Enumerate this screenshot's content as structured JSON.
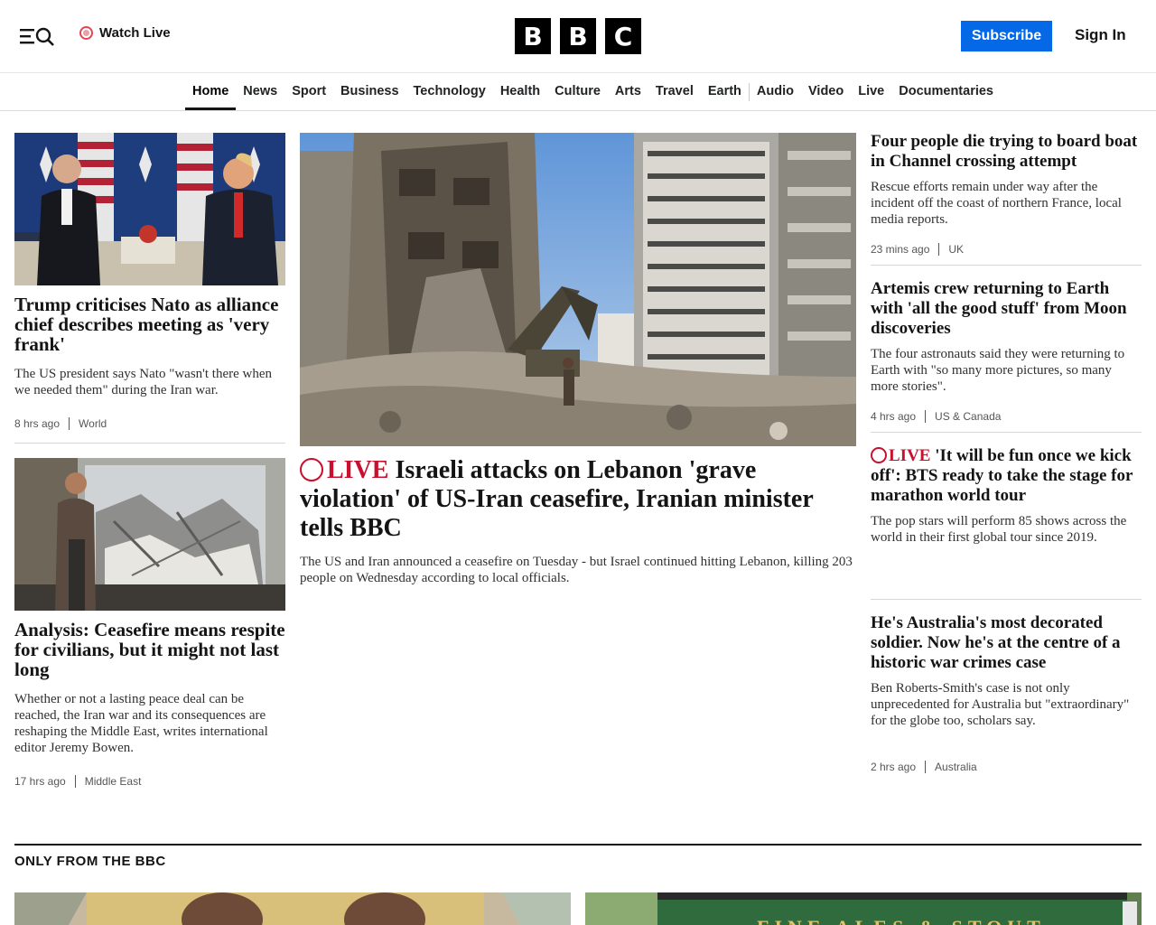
{
  "header": {
    "watch_live": "Watch Live",
    "logo_letters": [
      "B",
      "B",
      "C"
    ],
    "subscribe": "Subscribe",
    "sign_in": "Sign In"
  },
  "nav": {
    "items": [
      "Home",
      "News",
      "Sport",
      "Business",
      "Technology",
      "Health",
      "Culture",
      "Arts",
      "Travel",
      "Earth",
      "Audio",
      "Video",
      "Live",
      "Documentaries"
    ],
    "active": "Home"
  },
  "stories": {
    "left1": {
      "headline": "Trump criticises Nato as alliance chief describes meeting as 'very frank'",
      "summary": "The US president says Nato \"wasn't there when we needed them\" during the Iran war.",
      "time": "8 hrs ago",
      "topic": "World"
    },
    "left2": {
      "headline": "Analysis: Ceasefire means respite for civilians, but it might not last long",
      "summary": "Whether or not a lasting peace deal can be reached, the Iran war and its consequences are reshaping the Middle East, writes international editor Jeremy Bowen.",
      "time": "17 hrs ago",
      "topic": "Middle East"
    },
    "main": {
      "live_label": "LIVE",
      "headline": "Israeli attacks on Lebanon 'grave violation' of US-Iran ceasefire, Iranian minister tells BBC",
      "summary": "The US and Iran announced a ceasefire on Tuesday - but Israel continued hitting Lebanon, killing 203 people on Wednesday according to local officials."
    },
    "right1": {
      "headline": "Four people die trying to board boat in Channel crossing attempt",
      "summary": "Rescue efforts remain under way after the incident off the coast of northern France, local media reports.",
      "time": "23 mins ago",
      "topic": "UK"
    },
    "right2": {
      "headline": "Artemis crew returning to Earth with 'all the good stuff' from Moon discoveries",
      "summary": "The four astronauts said they were returning to Earth with \"so many more pictures, so many more stories\".",
      "time": "4 hrs ago",
      "topic": "US & Canada"
    },
    "right3": {
      "live_label": "LIVE",
      "headline": "'It will be fun once we kick off': BTS ready to take the stage for marathon world tour",
      "summary": "The pop stars will perform 85 shows across the world in their first global tour since 2019."
    },
    "right4": {
      "headline": "He's Australia's most decorated soldier. Now he's at the centre of a historic war crimes case",
      "summary": "Ben Roberts-Smith's case is not only unprecedented for Australia but \"extraordinary\" for the globe too, scholars say.",
      "time": "2 hrs ago",
      "topic": "Australia"
    }
  },
  "section": {
    "title": "ONLY FROM THE BBC",
    "banner_text": "FINE ALES & STOUT"
  },
  "colors": {
    "accent_blue": "#0568e6",
    "live_red": "#c8102e"
  }
}
